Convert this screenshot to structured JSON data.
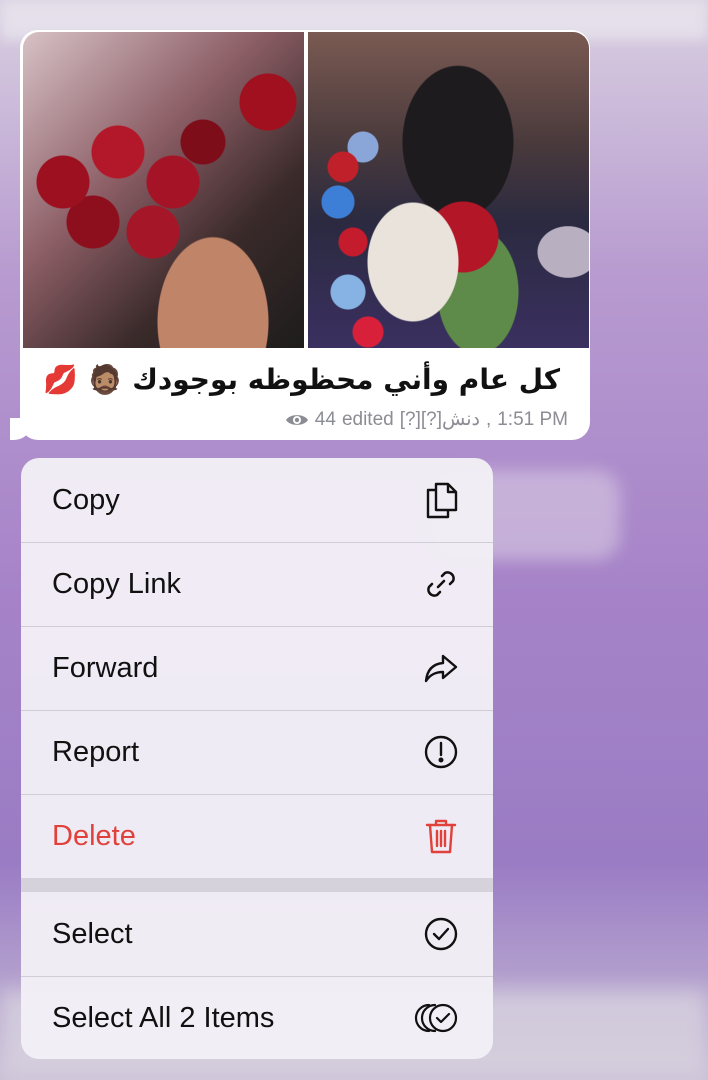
{
  "message": {
    "caption_text": "كل عام وأني محظوظه بوجودك",
    "caption_emoji_person": "🧔🏽",
    "caption_emoji_kiss": "💋",
    "views": "44",
    "edited_label": "edited",
    "author": "[?][?]دنش",
    "time": "1:51 PM",
    "photos": [
      {
        "name": "photo-roses-bouquet",
        "description": "bouquet of red roses"
      },
      {
        "name": "photo-couple-celebration",
        "description": "couple with balloons and roses"
      }
    ]
  },
  "menu": {
    "items": [
      {
        "label": "Copy",
        "icon": "copy-icon"
      },
      {
        "label": "Copy Link",
        "icon": "link-icon"
      },
      {
        "label": "Forward",
        "icon": "forward-icon"
      },
      {
        "label": "Report",
        "icon": "report-icon"
      },
      {
        "label": "Delete",
        "icon": "trash-icon"
      },
      {
        "label": "Select",
        "icon": "check-circle-icon"
      },
      {
        "label": "Select All 2 Items",
        "icon": "select-all-icon"
      }
    ]
  },
  "colors": {
    "delete": "#e0413b",
    "meta": "#8c8c94",
    "menu_bg": "#f2eff6"
  }
}
